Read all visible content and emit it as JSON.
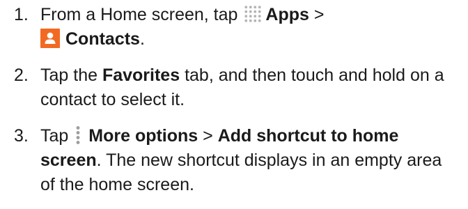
{
  "steps": [
    {
      "number": "1.",
      "part1": "From a Home screen, tap ",
      "apps_label": "Apps",
      "part2": " >",
      "contacts_label": "Contacts",
      "part3": "."
    },
    {
      "number": "2.",
      "part1": "Tap the ",
      "favorites_label": "Favorites",
      "part2": " tab, and then touch and hold on a contact to select it."
    },
    {
      "number": "3.",
      "part1": "Tap ",
      "more_options_label": "More options",
      "part2": " > ",
      "add_shortcut_label": "Add shortcut to home screen",
      "part3": ". The new shortcut displays in an empty area of the home screen."
    }
  ],
  "icons": {
    "apps": "apps-grid-icon",
    "contacts": "contacts-icon",
    "more_options": "more-options-icon"
  },
  "colors": {
    "contacts_icon_bg": "#f26a21",
    "apps_icon_dots": "#b5b5b5",
    "more_options_dots": "#9e9e9e",
    "text": "#1a1a1a"
  }
}
